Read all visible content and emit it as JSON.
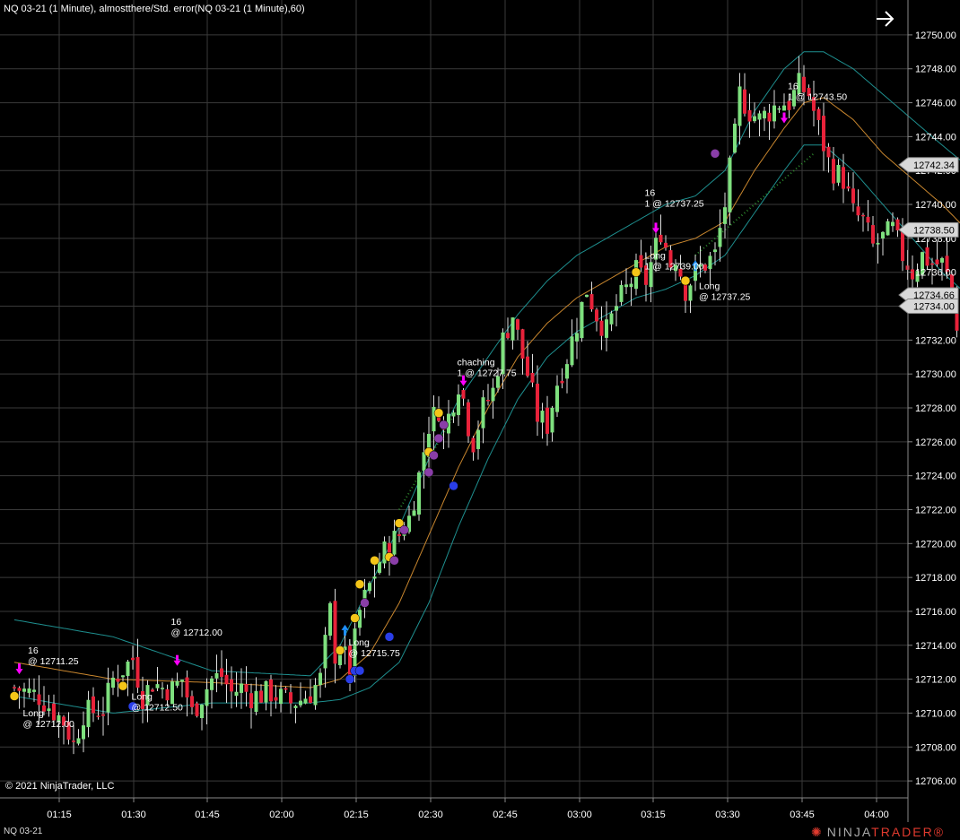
{
  "header": {
    "title": "NQ 03-21 (1 Minute), almostthere/Std. error(NQ 03-21 (1 Minute),60)"
  },
  "footer": {
    "copyright": "© 2021 NinjaTrader, LLC",
    "tab_label": "NQ 03-21",
    "brand_left": "NINJA",
    "brand_right": "TRADER",
    "brand_mark": "®"
  },
  "toolbar": {
    "nav_icon": "right-arrow-icon"
  },
  "colors": {
    "background": "#000000",
    "grid": "#3a3a3a",
    "up_candle": "#7ee07e",
    "down_candle": "#e8223a",
    "wick": "#dddddd",
    "mid_line": "#c8862e",
    "band": "#1e8f8f",
    "signal_yellow": "#f5c518",
    "signal_purple": "#8a3ea8",
    "signal_blue": "#2a3ee8",
    "arrow_magenta": "#ff00ff",
    "arrow_blue": "#1e90ff",
    "trend_dots": "#2e8b2e"
  },
  "chart_data": {
    "type": "candlestick",
    "symbol": "NQ 03-21",
    "interval": "1 Minute",
    "ylim": [
      12705,
      12751
    ],
    "y_ticks": [
      "12750.00",
      "12748.00",
      "12746.00",
      "12744.00",
      "12742.00",
      "12740.00",
      "12738.00",
      "12736.00",
      "12734.00",
      "12732.00",
      "12730.00",
      "12728.00",
      "12726.00",
      "12724.00",
      "12722.00",
      "12720.00",
      "12718.00",
      "12716.00",
      "12714.00",
      "12712.00",
      "12710.00",
      "12708.00",
      "12706.00"
    ],
    "x_ticks": [
      "01:15",
      "01:30",
      "01:45",
      "02:00",
      "02:15",
      "02:30",
      "02:45",
      "03:00",
      "03:15",
      "03:30",
      "03:45",
      "04:00"
    ],
    "price_markers": [
      {
        "label": "12742.34",
        "value": 12742.34
      },
      {
        "label": "12738.50",
        "value": 12738.5
      },
      {
        "label": "12734.66",
        "value": 12734.66
      },
      {
        "label": "12734.00",
        "value": 12734.0
      }
    ],
    "close_path": [
      [
        0,
        12711.5
      ],
      [
        5,
        12711.0
      ],
      [
        10,
        12709.5
      ],
      [
        12,
        12708.2
      ],
      [
        14,
        12710.0
      ],
      [
        18,
        12710.2
      ],
      [
        20,
        12712.0
      ],
      [
        22,
        12712.6
      ],
      [
        24,
        12713.2
      ],
      [
        26,
        12711.0
      ],
      [
        28,
        12711.8
      ],
      [
        30,
        12711.5
      ],
      [
        32,
        12711.4
      ],
      [
        34,
        12712.0
      ],
      [
        36,
        12710.0
      ],
      [
        38,
        12711.0
      ],
      [
        40,
        12712.0
      ],
      [
        42,
        12712.2
      ],
      [
        44,
        12711.2
      ],
      [
        46,
        12711.5
      ],
      [
        48,
        12711.0
      ],
      [
        52,
        12711.2
      ],
      [
        56,
        12710.6
      ],
      [
        58,
        12710.8
      ],
      [
        60,
        12711.2
      ],
      [
        62,
        12712.0
      ],
      [
        64,
        12716.0
      ],
      [
        65,
        12713.5
      ],
      [
        66,
        12714.0
      ],
      [
        68,
        12712.5
      ],
      [
        70,
        12716.0
      ],
      [
        72,
        12717.5
      ],
      [
        74,
        12719.0
      ],
      [
        76,
        12720.0
      ],
      [
        78,
        12720.5
      ],
      [
        80,
        12721.5
      ],
      [
        82,
        12724.0
      ],
      [
        84,
        12727.0
      ],
      [
        86,
        12728.0
      ],
      [
        87,
        12726.5
      ],
      [
        88,
        12727.5
      ],
      [
        90,
        12729.5
      ],
      [
        91,
        12728.5
      ],
      [
        92,
        12727.0
      ],
      [
        93,
        12726.0
      ],
      [
        95,
        12728.0
      ],
      [
        97,
        12729.0
      ],
      [
        99,
        12732.0
      ],
      [
        101,
        12733.5
      ],
      [
        103,
        12731.0
      ],
      [
        104,
        12730.0
      ],
      [
        106,
        12727.5
      ],
      [
        108,
        12727.0
      ],
      [
        110,
        12729.5
      ],
      [
        112,
        12731.0
      ],
      [
        114,
        12733.0
      ],
      [
        116,
        12735.0
      ],
      [
        118,
        12733.5
      ],
      [
        120,
        12732.5
      ],
      [
        122,
        12734.0
      ],
      [
        124,
        12735.0
      ],
      [
        126,
        12736.0
      ],
      [
        128,
        12735.5
      ],
      [
        130,
        12737.5
      ],
      [
        131,
        12738.5
      ],
      [
        133,
        12736.5
      ],
      [
        134,
        12737.0
      ],
      [
        136,
        12735.0
      ],
      [
        138,
        12736.0
      ],
      [
        140,
        12736.5
      ],
      [
        142,
        12737.0
      ],
      [
        144,
        12740.0
      ],
      [
        146,
        12744.0
      ],
      [
        147,
        12746.5
      ],
      [
        149,
        12745.5
      ],
      [
        151,
        12745.0
      ],
      [
        153,
        12745.5
      ],
      [
        155,
        12746.0
      ],
      [
        157,
        12746.0
      ],
      [
        159,
        12747.0
      ],
      [
        161,
        12746.5
      ],
      [
        163,
        12744.5
      ],
      [
        165,
        12742.5
      ],
      [
        166,
        12742.0
      ],
      [
        168,
        12741.5
      ],
      [
        170,
        12739.5
      ],
      [
        172,
        12739.0
      ],
      [
        174,
        12737.5
      ],
      [
        176,
        12738.0
      ],
      [
        178,
        12738.5
      ],
      [
        180,
        12737.0
      ],
      [
        182,
        12736.0
      ],
      [
        184,
        12737.0
      ],
      [
        186,
        12736.5
      ],
      [
        188,
        12736.5
      ],
      [
        190,
        12735.0
      ],
      [
        191,
        12733.0
      ],
      [
        192,
        12734.0
      ],
      [
        193,
        12734.0
      ]
    ],
    "series": [
      {
        "name": "mid",
        "points": [
          [
            0,
            12713.0
          ],
          [
            20,
            12712.0
          ],
          [
            40,
            12711.8
          ],
          [
            60,
            12711.5
          ],
          [
            66,
            12712.0
          ],
          [
            72,
            12713.5
          ],
          [
            78,
            12716.5
          ],
          [
            84,
            12720.5
          ],
          [
            90,
            12724.5
          ],
          [
            96,
            12728.0
          ],
          [
            102,
            12731.0
          ],
          [
            108,
            12733.0
          ],
          [
            114,
            12734.5
          ],
          [
            120,
            12735.5
          ],
          [
            126,
            12736.5
          ],
          [
            132,
            12737.5
          ],
          [
            138,
            12738.0
          ],
          [
            144,
            12739.0
          ],
          [
            150,
            12742.0
          ],
          [
            156,
            12744.5
          ],
          [
            160,
            12746.0
          ],
          [
            164,
            12746.3
          ],
          [
            170,
            12745.0
          ],
          [
            176,
            12743.0
          ],
          [
            182,
            12741.5
          ],
          [
            188,
            12740.0
          ],
          [
            193,
            12738.5
          ]
        ]
      },
      {
        "name": "upper",
        "points": [
          [
            0,
            12715.5
          ],
          [
            20,
            12714.5
          ],
          [
            40,
            12712.5
          ],
          [
            60,
            12712.2
          ],
          [
            66,
            12714.0
          ],
          [
            72,
            12717.5
          ],
          [
            78,
            12721.0
          ],
          [
            84,
            12725.0
          ],
          [
            90,
            12728.5
          ],
          [
            96,
            12731.0
          ],
          [
            102,
            12733.5
          ],
          [
            108,
            12735.5
          ],
          [
            114,
            12737.0
          ],
          [
            120,
            12738.0
          ],
          [
            126,
            12739.0
          ],
          [
            132,
            12740.0
          ],
          [
            138,
            12740.5
          ],
          [
            144,
            12742.0
          ],
          [
            150,
            12745.5
          ],
          [
            156,
            12748.0
          ],
          [
            160,
            12749.0
          ],
          [
            164,
            12749.0
          ],
          [
            170,
            12748.0
          ],
          [
            176,
            12746.5
          ],
          [
            182,
            12745.0
          ],
          [
            188,
            12743.5
          ],
          [
            193,
            12742.3
          ]
        ]
      },
      {
        "name": "lower",
        "points": [
          [
            0,
            12711.0
          ],
          [
            20,
            12710.0
          ],
          [
            40,
            12710.6
          ],
          [
            60,
            12710.6
          ],
          [
            66,
            12710.8
          ],
          [
            72,
            12711.5
          ],
          [
            78,
            12713.0
          ],
          [
            84,
            12716.5
          ],
          [
            90,
            12721.0
          ],
          [
            96,
            12725.0
          ],
          [
            102,
            12728.5
          ],
          [
            108,
            12731.0
          ],
          [
            114,
            12732.5
          ],
          [
            120,
            12733.5
          ],
          [
            126,
            12734.5
          ],
          [
            132,
            12735.0
          ],
          [
            138,
            12735.8
          ],
          [
            144,
            12737.0
          ],
          [
            150,
            12739.5
          ],
          [
            156,
            12742.0
          ],
          [
            160,
            12743.5
          ],
          [
            164,
            12743.5
          ],
          [
            170,
            12742.0
          ],
          [
            176,
            12740.0
          ],
          [
            182,
            12738.0
          ],
          [
            188,
            12736.0
          ],
          [
            193,
            12734.7
          ]
        ]
      }
    ],
    "signal_dots": [
      {
        "color": "yellow",
        "bar": 0,
        "y": 12711.0
      },
      {
        "color": "yellow",
        "bar": 22,
        "y": 12711.6
      },
      {
        "color": "blue",
        "bar": 24,
        "y": 12710.4
      },
      {
        "color": "yellow",
        "bar": 66,
        "y": 12713.7
      },
      {
        "color": "yellow",
        "bar": 69,
        "y": 12715.6
      },
      {
        "color": "yellow",
        "bar": 70,
        "y": 12717.6
      },
      {
        "color": "purple",
        "bar": 71,
        "y": 12716.5
      },
      {
        "color": "blue",
        "bar": 68,
        "y": 12712.0
      },
      {
        "color": "blue",
        "bar": 69,
        "y": 12712.5
      },
      {
        "color": "blue",
        "bar": 70,
        "y": 12712.5
      },
      {
        "color": "blue",
        "bar": 76,
        "y": 12714.5
      },
      {
        "color": "yellow",
        "bar": 73,
        "y": 12719.0
      },
      {
        "color": "yellow",
        "bar": 76,
        "y": 12719.2
      },
      {
        "color": "purple",
        "bar": 77,
        "y": 12719.0
      },
      {
        "color": "yellow",
        "bar": 78,
        "y": 12721.2
      },
      {
        "color": "purple",
        "bar": 79,
        "y": 12720.8
      },
      {
        "color": "yellow",
        "bar": 84,
        "y": 12725.4
      },
      {
        "color": "purple",
        "bar": 84,
        "y": 12724.2
      },
      {
        "color": "purple",
        "bar": 85,
        "y": 12725.2
      },
      {
        "color": "purple",
        "bar": 86,
        "y": 12726.2
      },
      {
        "color": "yellow",
        "bar": 86,
        "y": 12727.7
      },
      {
        "color": "purple",
        "bar": 87,
        "y": 12727.0
      },
      {
        "color": "blue",
        "bar": 89,
        "y": 12723.4
      },
      {
        "color": "yellow",
        "bar": 126,
        "y": 12736.0
      },
      {
        "color": "yellow",
        "bar": 136,
        "y": 12735.5
      },
      {
        "color": "purple",
        "bar": 142,
        "y": 12743.0
      }
    ],
    "arrows": [
      {
        "dir": "down",
        "color": "magenta",
        "bar": 1,
        "y": 12712.5
      },
      {
        "dir": "down",
        "color": "magenta",
        "bar": 33,
        "y": 12713.0
      },
      {
        "dir": "up",
        "color": "blue",
        "bar": 67,
        "y": 12715.0
      },
      {
        "dir": "down",
        "color": "magenta",
        "bar": 91,
        "y": 12729.5
      },
      {
        "dir": "down",
        "color": "magenta",
        "bar": 130,
        "y": 12738.5
      },
      {
        "dir": "up",
        "color": "blue",
        "bar": 138,
        "y": 12736.5
      },
      {
        "dir": "down",
        "color": "magenta",
        "bar": 156,
        "y": 12745.0
      }
    ],
    "annotations": [
      {
        "lines": [
          "16",
          "@ 12711.25"
        ],
        "bar": 2,
        "y": 12713.5
      },
      {
        "lines": [
          "Long",
          "@ 12712.00"
        ],
        "bar": 1,
        "y": 12709.8
      },
      {
        "lines": [
          "16",
          "@ 12712.00"
        ],
        "bar": 31,
        "y": 12715.2
      },
      {
        "lines": [
          "Long",
          "@ 12712.50"
        ],
        "bar": 23,
        "y": 12710.8
      },
      {
        "lines": [
          "Long",
          "@ 12715.75"
        ],
        "bar": 67,
        "y": 12714.0
      },
      {
        "lines": [
          "chaching",
          "1 @ 12727.75"
        ],
        "bar": 89,
        "y": 12730.5
      },
      {
        "lines": [
          "16",
          "1 @ 12737.25"
        ],
        "bar": 127,
        "y": 12740.5
      },
      {
        "lines": [
          "Long",
          "1 @ 12739.00"
        ],
        "bar": 127,
        "y": 12736.8
      },
      {
        "lines": [
          "Long",
          "@ 12737.25"
        ],
        "bar": 138,
        "y": 12735.0
      },
      {
        "lines": [
          "16",
          "1 @ 12743.50"
        ],
        "bar": 156,
        "y": 12746.8
      }
    ]
  }
}
